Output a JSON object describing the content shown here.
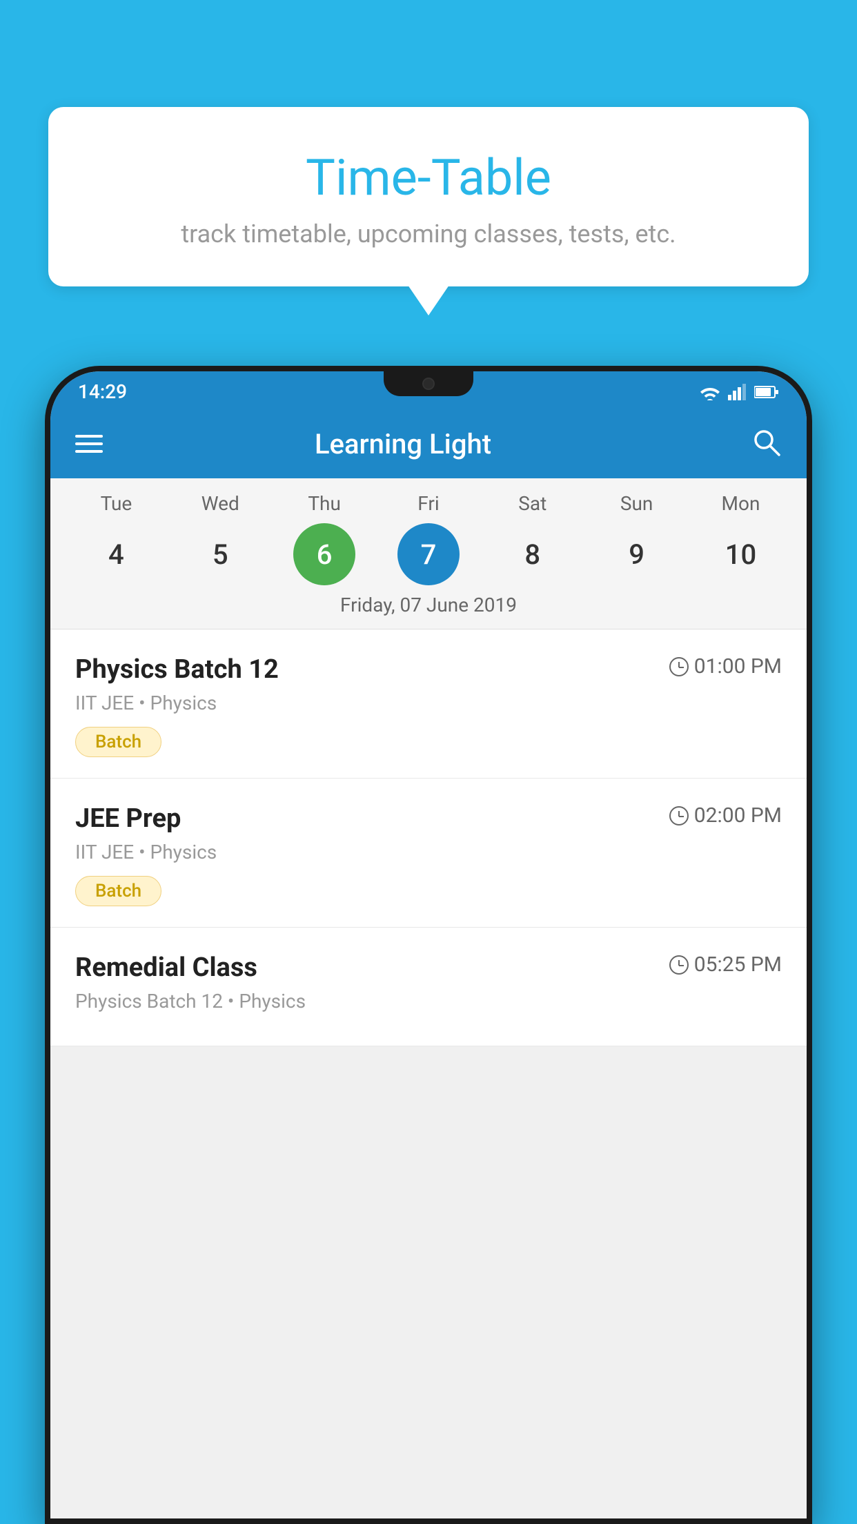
{
  "background_color": "#29b6e8",
  "tooltip": {
    "title": "Time-Table",
    "subtitle": "track timetable, upcoming classes, tests, etc."
  },
  "phone": {
    "status_bar": {
      "time": "14:29"
    },
    "app_bar": {
      "title": "Learning Light"
    },
    "calendar": {
      "days": [
        {
          "label": "Tue",
          "number": "4",
          "state": "normal"
        },
        {
          "label": "Wed",
          "number": "5",
          "state": "normal"
        },
        {
          "label": "Thu",
          "number": "6",
          "state": "today"
        },
        {
          "label": "Fri",
          "number": "7",
          "state": "selected"
        },
        {
          "label": "Sat",
          "number": "8",
          "state": "normal"
        },
        {
          "label": "Sun",
          "number": "9",
          "state": "normal"
        },
        {
          "label": "Mon",
          "number": "10",
          "state": "normal"
        }
      ],
      "selected_date_label": "Friday, 07 June 2019"
    },
    "schedule": [
      {
        "title": "Physics Batch 12",
        "time": "01:00 PM",
        "subtitle": "IIT JEE • Physics",
        "badge": "Batch"
      },
      {
        "title": "JEE Prep",
        "time": "02:00 PM",
        "subtitle": "IIT JEE • Physics",
        "badge": "Batch"
      },
      {
        "title": "Remedial Class",
        "time": "05:25 PM",
        "subtitle": "Physics Batch 12 • Physics",
        "badge": null
      }
    ]
  }
}
